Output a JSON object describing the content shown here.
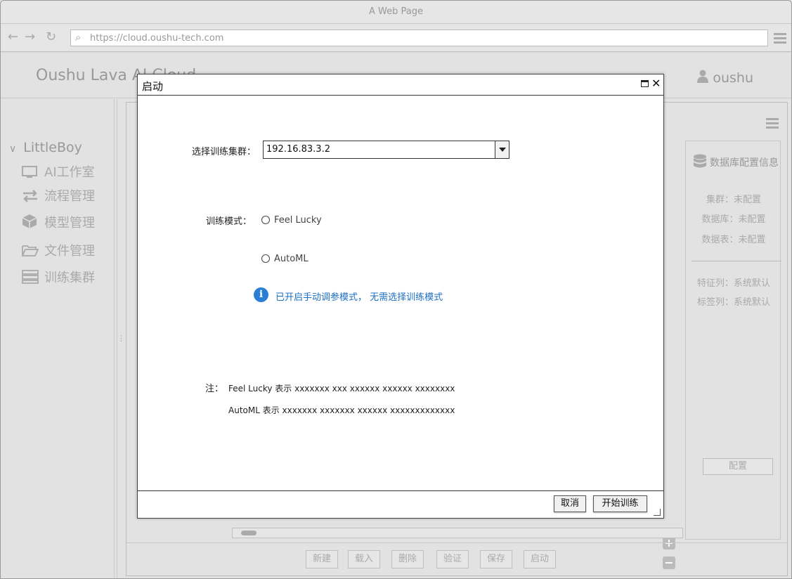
{
  "browser": {
    "title": "A Web Page",
    "url": "https://cloud.oushu-tech.com"
  },
  "app": {
    "logo": "Oushu Lava AI Cloud",
    "user": "oushu"
  },
  "sidebar": {
    "group": "LittleBoy",
    "items": [
      {
        "label": "AI工作室",
        "icon": "monitor-icon"
      },
      {
        "label": "流程管理",
        "icon": "flow-icon"
      },
      {
        "label": "模型管理",
        "icon": "cube-icon"
      },
      {
        "label": "文件管理",
        "icon": "folder-icon"
      },
      {
        "label": "训练集群",
        "icon": "server-icon"
      }
    ]
  },
  "right_panel": {
    "title": "数据库配置信息",
    "rows": [
      {
        "label": "集群：",
        "value": "未配置"
      },
      {
        "label": "数据库：",
        "value": "未配置"
      },
      {
        "label": "数据表：",
        "value": "未配置"
      },
      {
        "label": "特征列：",
        "value": "系统默认"
      },
      {
        "label": "标签列：",
        "value": "系统默认"
      }
    ],
    "config_button": "配置"
  },
  "bottom_bar": {
    "buttons": [
      "新建",
      "载入",
      "删除",
      "验证",
      "保存",
      "启动"
    ]
  },
  "modal": {
    "title": "启动",
    "cluster_label": "选择训练集群：",
    "cluster_value": "192.16.83.3.2",
    "mode_label": "训练模式：",
    "modes": [
      "Feel Lucky",
      "AutoML"
    ],
    "info_text": "已开启手动调参模式， 无需选择训练模式",
    "note_label": "注：",
    "notes": [
      "Feel Lucky 表示 xxxxxxx xxx xxxxxx xxxxxx xxxxxxxx",
      "AutoML 表示 xxxxxxx xxxxxxx xxxxxx xxxxxxxxxxxxx"
    ],
    "cancel_button": "取消",
    "start_button": "开始训练"
  },
  "colors": {
    "info_blue": "#1e6fc4",
    "info_icon": "#2a7fd4",
    "disabled_gray": "#aaaaaa"
  }
}
